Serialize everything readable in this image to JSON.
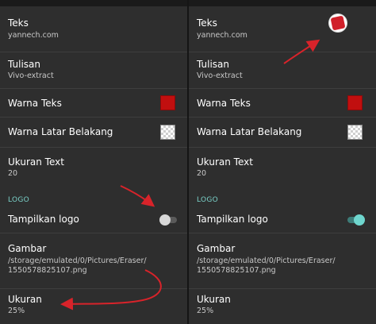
{
  "panels": [
    {
      "settings": {
        "teks": {
          "title": "Teks",
          "value": "yannech.com"
        },
        "tulisan": {
          "title": "Tulisan",
          "value": "Vivo-extract"
        },
        "warna_teks": {
          "title": "Warna Teks",
          "color": "#c10f0f"
        },
        "warna_latar": {
          "title": "Warna Latar Belakang"
        },
        "ukuran_text": {
          "title": "Ukuran Text",
          "value": "20"
        },
        "section_logo": "LOGO",
        "tampilkan_logo": {
          "title": "Tampilkan logo",
          "checked": false
        },
        "gambar": {
          "title": "Gambar",
          "path_line1": "/storage/emulated/0/Pictures/Eraser/",
          "path_line2": "1550578825107.png"
        },
        "ukuran": {
          "title": "Ukuran",
          "value": "25%"
        }
      }
    },
    {
      "settings": {
        "teks": {
          "title": "Teks",
          "value": "yannech.com"
        },
        "tulisan": {
          "title": "Tulisan",
          "value": "Vivo-extract"
        },
        "warna_teks": {
          "title": "Warna Teks",
          "color": "#c10f0f"
        },
        "warna_latar": {
          "title": "Warna Latar Belakang"
        },
        "ukuran_text": {
          "title": "Ukuran Text",
          "value": "20"
        },
        "section_logo": "LOGO",
        "tampilkan_logo": {
          "title": "Tampilkan logo",
          "checked": true
        },
        "gambar": {
          "title": "Gambar",
          "path_line1": "/storage/emulated/0/Pictures/Eraser/",
          "path_line2": "1550578825107.png"
        },
        "ukuran": {
          "title": "Ukuran",
          "value": "25%"
        }
      }
    }
  ],
  "colors": {
    "background": "#2e2e2e",
    "accent": "#6fd6ce",
    "annotation": "#d8232a"
  }
}
